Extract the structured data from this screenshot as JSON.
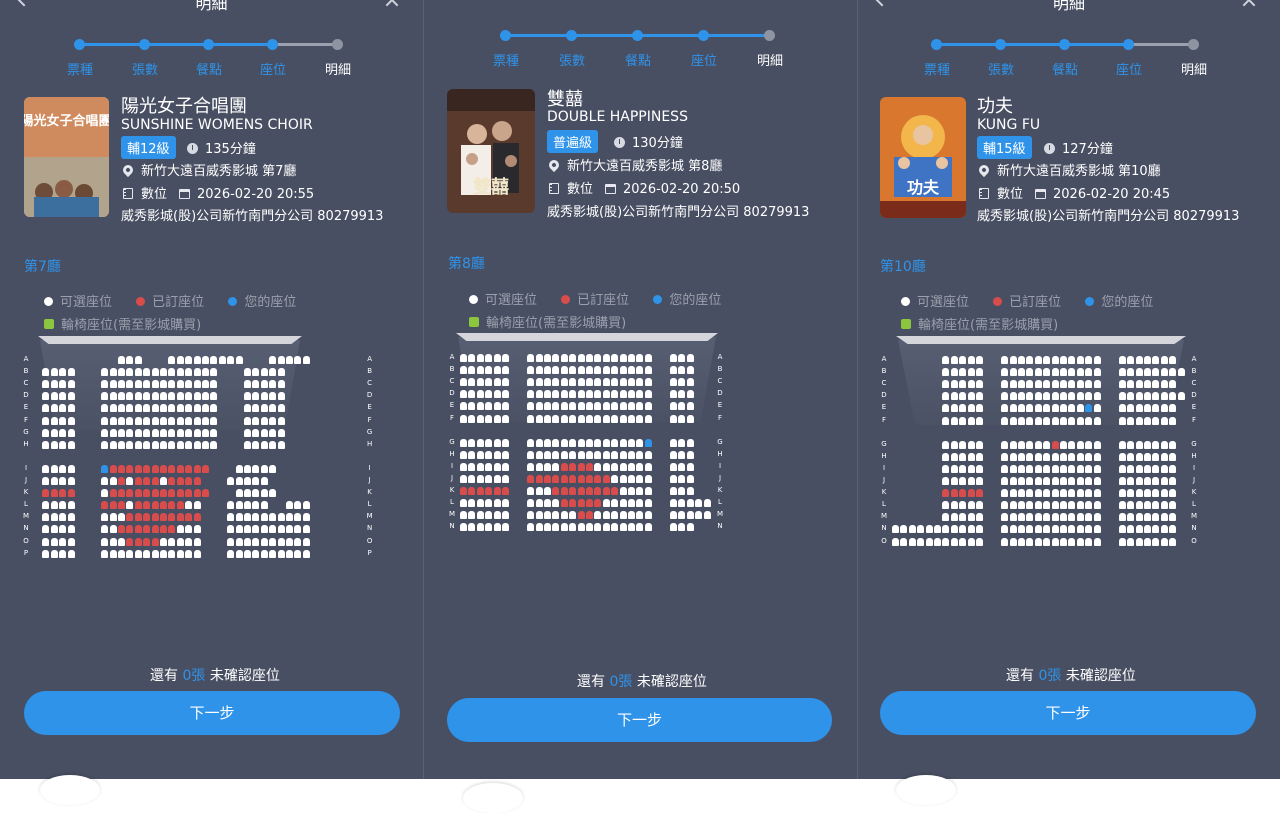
{
  "colors": {
    "panel_bg": "#484f62",
    "accent": "#2f93ea",
    "available": "#ffffff",
    "booked": "#d94c4c",
    "yours": "#2f93ea",
    "wheelchair": "#8cc63f"
  },
  "header": {
    "title": "明細",
    "back_icon": "chevron-left-icon",
    "close_icon": "close-icon"
  },
  "steps": [
    "票種",
    "張數",
    "餐點",
    "座位",
    "明細"
  ],
  "legend": {
    "available": "可選座位",
    "booked": "已訂座位",
    "yours": "您的座位",
    "wheelchair": "輪椅座位(需至影城購買)"
  },
  "pending": {
    "prefix": "還有",
    "count": "0張",
    "suffix": "未確認座位"
  },
  "next_label": "下一步",
  "panels": [
    {
      "title_zh": "陽光女子合唱團",
      "title_en": "SUNSHINE WOMENS CHOIR",
      "rating": "輔12級",
      "duration": "135分鐘",
      "location": "新竹大遠百威秀影城 第7廳",
      "format": "數位",
      "datetime": "2026-02-20 20:55",
      "company": "威秀影城(股)公司新竹南門分公司 80279913",
      "hall": "第7廳",
      "poster_text": "陽光女子合唱團",
      "rows_left": [
        "A",
        "B",
        "C",
        "D",
        "E",
        "F",
        "G",
        "H",
        "",
        "I",
        "J",
        "K",
        "L",
        "M",
        "N",
        "O",
        "P"
      ],
      "rows_right": [
        "A",
        "B",
        "C",
        "D",
        "E",
        "F",
        "G",
        "H",
        "",
        "I",
        "J",
        "K",
        "L",
        "M",
        "N",
        "O",
        "P"
      ],
      "seat_rows": [
        "..........xxx...xxxxxxxxx...xxxxx......",
        ".xxxx...xxxxxxxxxxxxxx...xxxxx.........",
        ".xxxx...xxxxxxxxxxxxxx...xxxxx.........",
        ".xxxx...xxxxxxxxxxxxxx...xxxxx.........",
        ".xxxx...xxxxxxxxxxxxxx...xxxxx.........",
        ".xxxx...xxxxxxxxxxxxxx...xxxxx.........",
        ".xxxx...xxxxxxxxxxxxxx...xxxxx.........",
        ".xxxx...xxxxxxxxxxxxxx...xxxxx.........",
        "",
        ".xxxx...Yrrrrrrrrrrrr...xxxxx.........",
        ".xxxx...xxrxrrrxrrrr...xxxxx..........",
        ".rrrr...xrrrrrrrrrrrr...xxxxx.........",
        ".xxxx...rrrxrrrrrrxx...xxxxx..xxx.....",
        ".xxxx...xxxrrrrrrrrr...xxxxxxxxxx.....",
        ".xxxx...xxrrrrrrrxxx...xxxxxxxxxx.....",
        ".xxxx...xxxrrrrxxxxx...xxxxxxxxxx.....",
        ".xxxx...xxxxxxxxxxxx...xxxxxxxxxx....."
      ]
    },
    {
      "title_zh": "雙囍",
      "title_en": "DOUBLE HAPPINESS",
      "rating": "普遍級",
      "duration": "130分鐘",
      "location": "新竹大遠百威秀影城 第8廳",
      "format": "數位",
      "datetime": "2026-02-20 20:50",
      "company": "威秀影城(股)公司新竹南門分公司 80279913",
      "hall": "第8廳",
      "poster_text": "雙囍",
      "rows_left": [
        "A",
        "B",
        "C",
        "D",
        "E",
        "F",
        "",
        "G",
        "H",
        "I",
        "J",
        "K",
        "L",
        "M",
        "N"
      ],
      "rows_right": [
        "A",
        "B",
        "C",
        "D",
        "E",
        "F",
        "",
        "G",
        "H",
        "I",
        "J",
        "K",
        "L",
        "M",
        "N"
      ],
      "seat_rows": [
        "xxxxxx..xxxxxxxxxxxxxxx..xxx",
        "xxxxxx..xxxxxxxxxxxxxxx..xxx",
        "xxxxxx..xxxxxxxxxxxxxxx..xxx",
        "xxxxxx..xxxxxxxxxxxxxxx..xxx",
        "xxxxxx..xxxxxxxxxxxxxxx..xxx",
        "xxxxxx..xxxxxxxxxxxxxxx..xxx",
        "",
        "xxxxxx..xxxxxxxxxxxxxxY..xxx",
        "xxxxxx..xxxxxxxxxxxxxxx..xxx",
        "xxxxxx..xxxxrrrrxxxxxxx..xxx",
        "xxxxxx..rrrrrrrrrrxxxxx..xxx",
        "rrrrrr..xxxrrrrrrrrxxxx..xxx",
        "xxxxxx..xxxxrrrrrxxxxxx..xxxxx",
        "xxxxxx..xxxxxxrrxxxxxxx..xxxxx",
        "xxxxxx..xxxxxxxxxxxxxxx..xxx"
      ]
    },
    {
      "title_zh": "功夫",
      "title_en": "KUNG FU",
      "rating": "輔15級",
      "duration": "127分鐘",
      "location": "新竹大遠百威秀影城 第10廳",
      "format": "數位",
      "datetime": "2026-02-20 20:45",
      "company": "威秀影城(股)公司新竹南門分公司 80279913",
      "hall": "第10廳",
      "poster_text": "功夫",
      "rows_left": [
        "A",
        "B",
        "C",
        "D",
        "E",
        "F",
        "",
        "G",
        "H",
        "I",
        "J",
        "K",
        "L",
        "M",
        "N",
        "O"
      ],
      "rows_right": [
        "A",
        "B",
        "C",
        "D",
        "E",
        "F",
        "",
        "G",
        "H",
        "I",
        "J",
        "K",
        "L",
        "M",
        "N",
        "O"
      ],
      "seat_rows": [
        "......xxxxx..xxxxxxxxxxxx..xxxxxxx.",
        "......xxxxx..xxxxxxxxxxxx..xxxxxxxx",
        "......xxxxx..xxxxxxxxxxxx..xxxxxxx.",
        "......xxxxx..xxxxxxxxxxxx..xxxxxxxx",
        "......xxxxx..xxxxxxxxxxYx..xxxxxxx.",
        "......xxxxx..xxxxxxxxxxxx..xxxxxxx.",
        "",
        "......xxxxx..xxxxxxrxxxxx..xxxxxxx.",
        "......xxxxx..xxxxxxxxxxxx..xxxxxxx.",
        "......xxxxx..xxxxxxxxxxxx..xxxxxxx.",
        "......xxxxx..xxxxxxxxxxxx..xxxxxxx.",
        "......rrrrr..xxxxxxxxxxxx..xxxxxxx.",
        "......xxxxx..xxxxxxxxxxxx..xxxxxxx.",
        "......xxxxx..xxxxxxxxxxxx..xxxxxxx.",
        "xxxxxxxxxxx..xxxxxxxxxxxx..xxxxxxx.",
        "xxxxxxxxxxx..xxxxxxxxxxxx..xxxxxxx."
      ]
    }
  ]
}
